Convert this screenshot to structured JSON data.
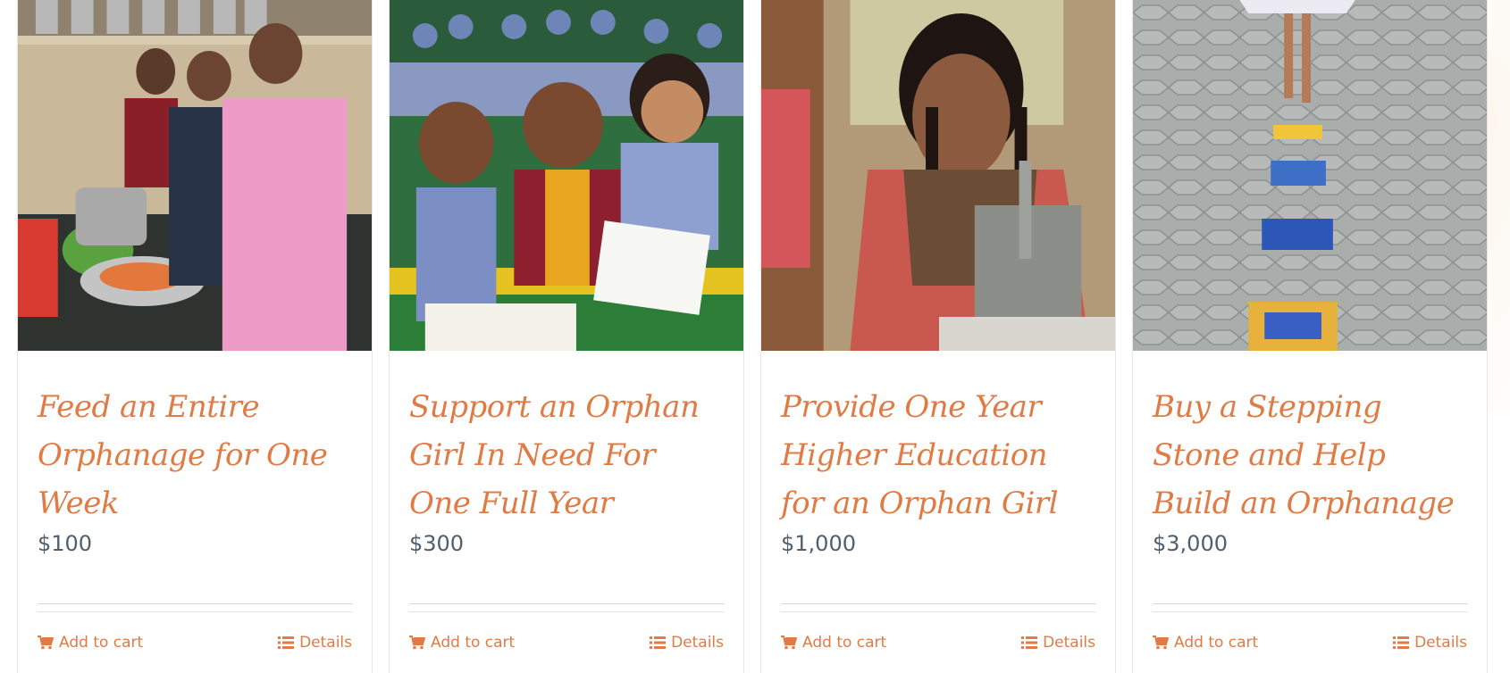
{
  "colors": {
    "accent": "#e07b45",
    "price": "#4f5f6b",
    "border": "#e6e6e6"
  },
  "products": [
    {
      "title": "Feed an Entire Orphanage for One Week",
      "price": "$100",
      "add_to_cart": "Add to cart",
      "details": "Details",
      "image_icon": "kitchen-photo"
    },
    {
      "title": "Support an Orphan Girl In Need For One Full Year",
      "price": "$300",
      "add_to_cart": "Add to cart",
      "details": "Details",
      "image_icon": "classroom-photo"
    },
    {
      "title": "Provide One Year Higher Education for an Orphan Girl",
      "price": "$1,000",
      "add_to_cart": "Add to cart",
      "details": "Details",
      "image_icon": "lab-photo"
    },
    {
      "title": "Buy a Stepping Stone and Help Build an Orphanage",
      "price": "$3,000",
      "add_to_cart": "Add to cart",
      "details": "Details",
      "image_icon": "paving-photo"
    }
  ]
}
